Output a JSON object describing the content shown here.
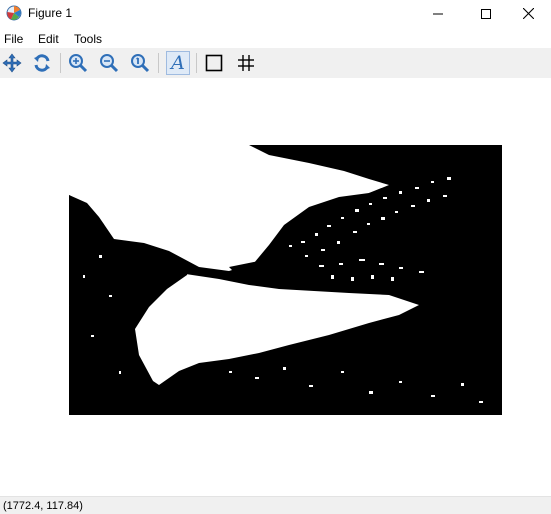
{
  "window": {
    "title": "Figure 1",
    "app_icon": "matplotlib-logo-icon",
    "controls": [
      "minimize-icon",
      "maximize-icon",
      "close-icon"
    ]
  },
  "menu": {
    "items": [
      {
        "label": "File"
      },
      {
        "label": "Edit"
      },
      {
        "label": "Tools"
      }
    ]
  },
  "toolbar": {
    "tools": [
      {
        "icon": "pan-icon"
      },
      {
        "icon": "rotate-icon"
      },
      {
        "icon": "zoom-in-icon"
      },
      {
        "icon": "zoom-out-icon"
      },
      {
        "icon": "zoom-fit-icon"
      },
      {
        "icon": "text-icon",
        "glyph": "A"
      },
      {
        "icon": "rectangle-icon"
      },
      {
        "icon": "grid-icon"
      }
    ]
  },
  "figure": {
    "content": "binary thresholded landscape image (lake with mountains)",
    "colors": {
      "foreground": "#000000",
      "background": "#ffffff"
    }
  },
  "statusbar": {
    "coords": "(1772.4, 117.84)"
  },
  "colors": {
    "toolbar_bg": "#f0f0f0",
    "accent_blue": "#2f6fb8"
  }
}
